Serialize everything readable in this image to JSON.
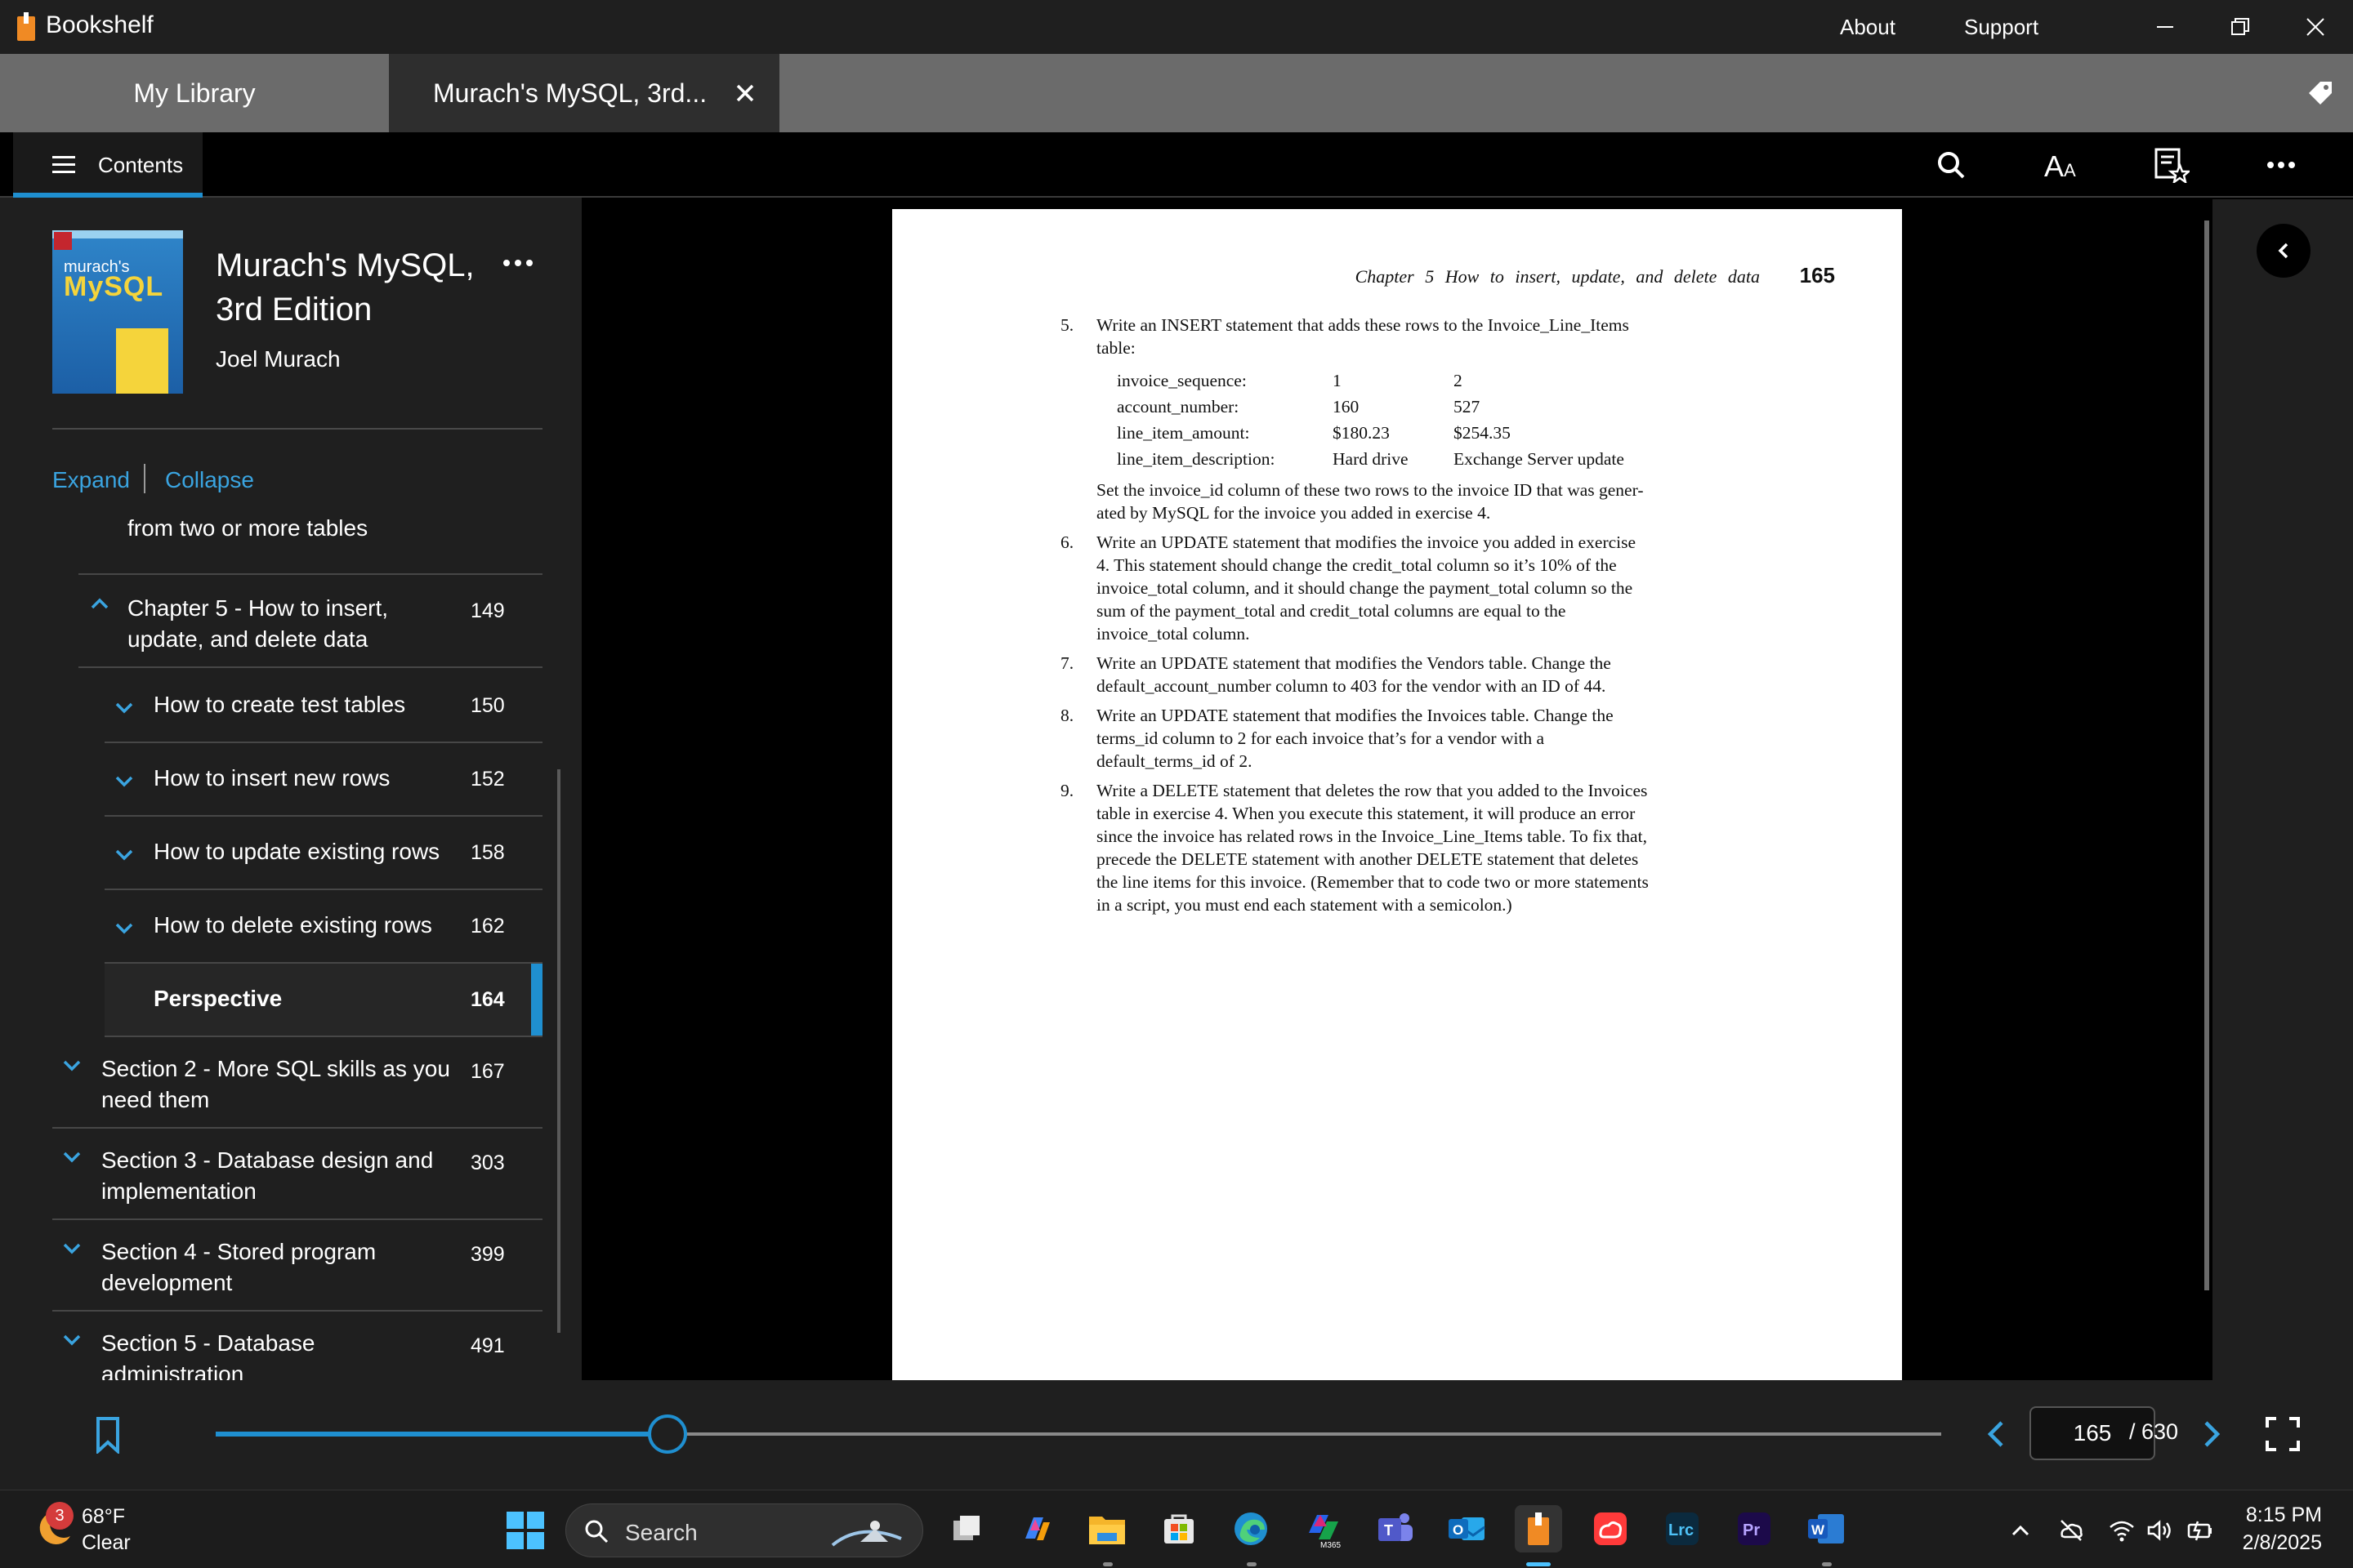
{
  "window": {
    "app_title": "Bookshelf",
    "about_label": "About",
    "support_label": "Support",
    "minimize_icon": "minimize-icon",
    "restore_icon": "restore-icon",
    "close_icon": "close-icon"
  },
  "tabs": [
    {
      "label": "My Library",
      "active": false
    },
    {
      "label": "Murach's MySQL,  3rd...",
      "active": true
    }
  ],
  "toolbar": {
    "contents_label": "Contents",
    "icons": [
      "search-icon",
      "text-size-icon",
      "bookmarks-list-icon",
      "more-icon"
    ]
  },
  "sidebar": {
    "cover": {
      "brand": "murach's",
      "title": "MySQL"
    },
    "book_title": "Murach's MySQL, 3rd Edition",
    "book_author": "Joel Murach",
    "expand_label": "Expand",
    "collapse_label": "Collapse",
    "toc": [
      {
        "label": "from two or more tables",
        "page": "",
        "level": 1,
        "expanded": null
      },
      {
        "label": "Chapter 5 - How to insert, update, and delete data",
        "page": "149",
        "level": 1,
        "expanded": true
      },
      {
        "label": "How to create test tables",
        "page": "150",
        "level": 2,
        "expanded": false
      },
      {
        "label": "How to insert new rows",
        "page": "152",
        "level": 2,
        "expanded": false
      },
      {
        "label": "How to update existing rows",
        "page": "158",
        "level": 2,
        "expanded": false
      },
      {
        "label": "How to delete existing rows",
        "page": "162",
        "level": 2,
        "expanded": false
      },
      {
        "label": "Perspective",
        "page": "164",
        "level": 2,
        "expanded": null,
        "active": true
      },
      {
        "label": "Section 2 - More SQL skills as you need them",
        "page": "167",
        "level": 0,
        "expanded": false
      },
      {
        "label": "Section 3 - Database design and implementation",
        "page": "303",
        "level": 0,
        "expanded": false
      },
      {
        "label": "Section 4 - Stored program development",
        "page": "399",
        "level": 0,
        "expanded": false
      },
      {
        "label": "Section 5 - Database administration",
        "page": "491",
        "level": 0,
        "expanded": false
      }
    ]
  },
  "page": {
    "running_head": "Chapter 5    How to insert, update, and delete data",
    "page_number": "165",
    "exercises": [
      {
        "num": "5.",
        "lines": [
          "Write an INSERT statement that adds these rows to the Invoice_Line_Items",
          "table:"
        ]
      },
      {
        "num": "",
        "lines": [
          "Set the invoice_id column of these two rows to the invoice ID that was gener-",
          "ated by MySQL for the invoice you added in exercise 4."
        ]
      },
      {
        "num": "6.",
        "lines": [
          "Write an UPDATE statement that modifies the invoice you added in exercise",
          "4. This statement should change the credit_total column so it’s 10% of the",
          "invoice_total column, and it should change the payment_total column so the",
          "sum of the payment_total and credit_total columns are equal to the",
          "invoice_total column."
        ]
      },
      {
        "num": "7.",
        "lines": [
          "Write an UPDATE statement that modifies the Vendors table. Change the",
          "default_account_number column to 403 for the vendor with an ID of 44."
        ]
      },
      {
        "num": "8.",
        "lines": [
          "Write an UPDATE statement that modifies the Invoices table. Change the",
          "terms_id column to 2 for each invoice that’s for a vendor with a",
          "default_terms_id of 2."
        ]
      },
      {
        "num": "9.",
        "lines": [
          "Write a DELETE statement that deletes the row that you added to the Invoices",
          "table in exercise 4. When you execute this statement, it will produce an error",
          "since the invoice has related rows in the Invoice_Line_Items table. To fix that,",
          "precede the DELETE statement with another DELETE statement that deletes",
          "the line items for this invoice. (Remember that to code two or more statements",
          "in a script, you must end each statement with a semicolon.)"
        ]
      }
    ],
    "insert_table": [
      [
        "invoice_sequence:",
        "1",
        "2"
      ],
      [
        "account_number:",
        "160",
        "527"
      ],
      [
        "line_item_amount:",
        "$180.23",
        "$254.35"
      ],
      [
        "line_item_description:",
        "Hard drive",
        "Exchange Server update"
      ]
    ]
  },
  "navigation": {
    "current_page": "165",
    "total_pages": "/ 630",
    "progress": 0.262
  },
  "taskbar": {
    "weather_badge": "3",
    "weather_temp": "68°F",
    "weather_desc": "Clear",
    "search_label": "Search",
    "apps": [
      "task-view-icon",
      "copilot-icon",
      "file-explorer-icon",
      "microsoft-store-icon",
      "edge-icon",
      "m365-icon",
      "teams-icon",
      "outlook-icon",
      "bookshelf-icon",
      "creative-cloud-icon",
      "lightroom-classic-icon",
      "premiere-pro-icon",
      "word-icon"
    ],
    "app_labels": {
      "lrc": "Lrc",
      "pr": "Pr",
      "word": "W",
      "outlook": "O",
      "teams": "T",
      "m365": "M365"
    },
    "time": "8:15 PM",
    "date": "2/8/2025"
  }
}
